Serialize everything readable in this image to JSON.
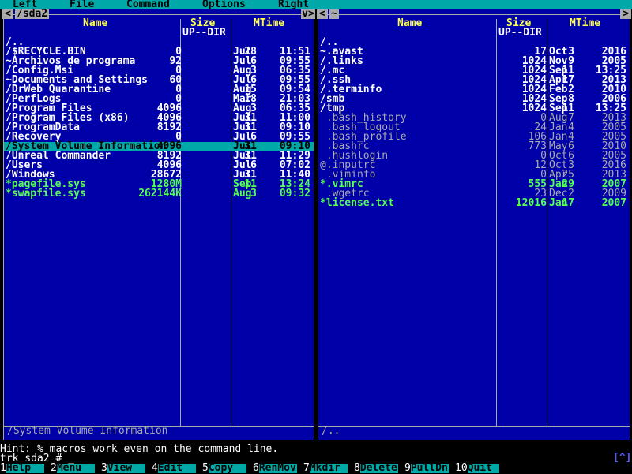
{
  "menu": [
    "Left",
    "File",
    "Command",
    "Options",
    "Right"
  ],
  "left_panel": {
    "path": "/sda2",
    "nav_left": "<",
    "nav_right": "v>",
    "headers": {
      "name": "Name",
      "size": "Size",
      "mtime": "MTime"
    },
    "up_label": "UP--DIR",
    "mini_status": "/System Volume Information",
    "rows": [
      {
        "name": "/..",
        "size": "",
        "month": "",
        "day": "",
        "time": "",
        "type": "dir"
      },
      {
        "name": "/$RECYCLE.BIN",
        "size": "0",
        "month": "Jul",
        "day": "28",
        "time": "11:51",
        "type": "dir"
      },
      {
        "name": "~Archivos de programa",
        "size": "92",
        "month": "Jul",
        "day": "6",
        "time": "09:55",
        "type": "dir"
      },
      {
        "name": "/Config.Msi",
        "size": "0",
        "month": "Aug",
        "day": "3",
        "time": "06:35",
        "type": "dir"
      },
      {
        "name": "~Documents and Settings",
        "size": "60",
        "month": "Jul",
        "day": "6",
        "time": "09:55",
        "type": "dir"
      },
      {
        "name": "/DrWeb Quarantine",
        "size": "0",
        "month": "Aug",
        "day": "15",
        "time": "09:54",
        "type": "dir"
      },
      {
        "name": "/PerfLogs",
        "size": "0",
        "month": "Mar",
        "day": "18",
        "time": "21:03",
        "type": "dir"
      },
      {
        "name": "/Program Files",
        "size": "4096",
        "month": "Aug",
        "day": "3",
        "time": "06:35",
        "type": "dir"
      },
      {
        "name": "/Program Files (x86)",
        "size": "4096",
        "month": "Jul",
        "day": "31",
        "time": "11:00",
        "type": "dir"
      },
      {
        "name": "/ProgramData",
        "size": "8192",
        "month": "Jul",
        "day": "31",
        "time": "09:10",
        "type": "dir"
      },
      {
        "name": "/Recovery",
        "size": "0",
        "month": "Jul",
        "day": "6",
        "time": "09:55",
        "type": "dir"
      },
      {
        "name": "/System Volume Information",
        "size": "4096",
        "month": "Jul",
        "day": "31",
        "time": "09:10",
        "type": "sel"
      },
      {
        "name": "/Unreal Commander",
        "size": "8192",
        "month": "Jul",
        "day": "31",
        "time": "11:29",
        "type": "dir"
      },
      {
        "name": "/Users",
        "size": "4096",
        "month": "Jul",
        "day": "6",
        "time": "07:02",
        "type": "dir"
      },
      {
        "name": "/Windows",
        "size": "28672",
        "month": "Jul",
        "day": "31",
        "time": "11:40",
        "type": "dir"
      },
      {
        "name": "*pagefile.sys",
        "size": "1280M",
        "month": "Sep",
        "day": "11",
        "time": "13:24",
        "type": "exec"
      },
      {
        "name": "*swapfile.sys",
        "size": "262144K",
        "month": "Aug",
        "day": "3",
        "time": "09:32",
        "type": "exec"
      }
    ]
  },
  "right_panel": {
    "path": "~",
    "nav_left": "<",
    "nav_right": ">",
    "headers": {
      "name": "Name",
      "size": "Size",
      "mtime": "MTime"
    },
    "up_label": "UP--DIR",
    "mini_status": "/..",
    "rows": [
      {
        "name": "/..",
        "size": "",
        "month": "",
        "day": "",
        "time": "",
        "type": "dir"
      },
      {
        "name": "~.avast",
        "size": "17",
        "month": "Oct",
        "day": "3",
        "time": "2016",
        "type": "dir"
      },
      {
        "name": "/.links",
        "size": "1024",
        "month": "Nov",
        "day": "9",
        "time": "2005",
        "type": "dir"
      },
      {
        "name": "/.mc",
        "size": "1024",
        "month": "Sep",
        "day": "11",
        "time": "13:25",
        "type": "dir"
      },
      {
        "name": "/.ssh",
        "size": "1024",
        "month": "Apr",
        "day": "17",
        "time": "2013",
        "type": "dir"
      },
      {
        "name": "/.terminfo",
        "size": "1024",
        "month": "Feb",
        "day": "2",
        "time": "2010",
        "type": "dir"
      },
      {
        "name": "/smb",
        "size": "1024",
        "month": "Sep",
        "day": "8",
        "time": "2006",
        "type": "dir"
      },
      {
        "name": "/tmp",
        "size": "1024",
        "month": "Sep",
        "day": "11",
        "time": "13:25",
        "type": "dir"
      },
      {
        "name": " .bash_history",
        "size": "0",
        "month": "Aug",
        "day": "7",
        "time": "2013",
        "type": "file"
      },
      {
        "name": " .bash_logout",
        "size": "24",
        "month": "Jan",
        "day": "4",
        "time": "2005",
        "type": "file"
      },
      {
        "name": " .bash_profile",
        "size": "106",
        "month": "Jan",
        "day": "4",
        "time": "2005",
        "type": "file"
      },
      {
        "name": " .bashrc",
        "size": "773",
        "month": "May",
        "day": "6",
        "time": "2010",
        "type": "file"
      },
      {
        "name": " .hushlogin",
        "size": "0",
        "month": "Oct",
        "day": "6",
        "time": "2005",
        "type": "file"
      },
      {
        "name": "@.inputrc",
        "size": "12",
        "month": "Oct",
        "day": "3",
        "time": "2016",
        "type": "file"
      },
      {
        "name": " .viminfo",
        "size": "0",
        "month": "Apr",
        "day": "25",
        "time": "2013",
        "type": "file"
      },
      {
        "name": "*.vimrc",
        "size": "555",
        "month": "Jan",
        "day": "29",
        "time": "2007",
        "type": "exec"
      },
      {
        "name": " .wgetrc",
        "size": "23",
        "month": "Dec",
        "day": "2",
        "time": "2009",
        "type": "file"
      },
      {
        "name": "*license.txt",
        "size": "12016",
        "month": "Jan",
        "day": "17",
        "time": "2007",
        "type": "exec"
      }
    ]
  },
  "hint": "Hint: % macros work even on the command line.",
  "prompt": "trk sda2 # _",
  "prompt_button": "[^]",
  "fkeys": [
    {
      "num": "1",
      "label": "Help"
    },
    {
      "num": "2",
      "label": "Menu"
    },
    {
      "num": "3",
      "label": "View"
    },
    {
      "num": "4",
      "label": "Edit"
    },
    {
      "num": "5",
      "label": "Copy"
    },
    {
      "num": "6",
      "label": "RenMov"
    },
    {
      "num": "7",
      "label": "Mkdir"
    },
    {
      "num": "8",
      "label": "Delete"
    },
    {
      "num": "9",
      "label": "PullDn"
    },
    {
      "num": "10",
      "label": "Quit"
    }
  ]
}
